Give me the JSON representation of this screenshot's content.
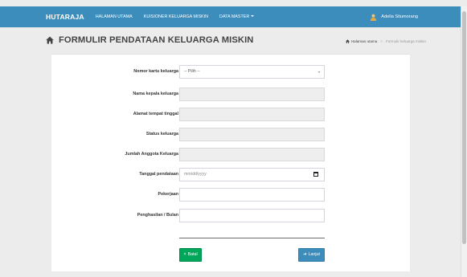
{
  "navbar": {
    "brand": "HUTARAJA",
    "links": [
      {
        "label": "HALAMAN UTAMA"
      },
      {
        "label": "KUISIONER KELUARGA MISKIN"
      },
      {
        "label": "DATA MASTER"
      }
    ],
    "user_name": "Adelia Situmorang",
    "color": "#3c8dbc"
  },
  "page": {
    "title": "FORMULIR PENDATAAN KELUARGA MISKIN",
    "breadcrumb": {
      "home": "Halaman utama",
      "current": "Formulir keluarga miskin"
    }
  },
  "form": {
    "fields": [
      {
        "label": "Nomor kartu keluarga",
        "value": "-- Pilih --",
        "type": "select"
      },
      {
        "label": "Nama kepala keluarga",
        "value": "",
        "type": "disabled"
      },
      {
        "label": "Alamat tempat tinggal",
        "value": "",
        "type": "disabled"
      },
      {
        "label": "Status keluarga",
        "value": "",
        "type": "disabled"
      },
      {
        "label": "Jumlah Anggota Keluarga",
        "value": "",
        "type": "disabled"
      },
      {
        "label": "Tanggal pendataan",
        "placeholder": "mm/dd/yyyy",
        "type": "date"
      },
      {
        "label": "Pekerjaan",
        "value": "",
        "type": "text"
      },
      {
        "label": "Penghasilan / Bulan",
        "value": "",
        "type": "text"
      }
    ],
    "buttons": {
      "cancel": {
        "icon": "×",
        "label": "Batal",
        "color": "#00a65a"
      },
      "next": {
        "icon": "➜",
        "label": "Lanjut",
        "color": "#3c8dbc"
      }
    }
  }
}
